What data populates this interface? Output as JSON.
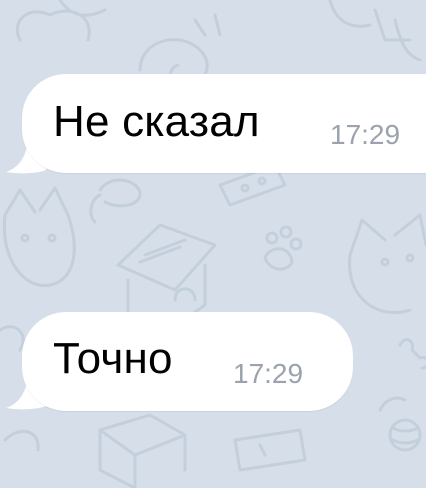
{
  "chat": {
    "background_color": "#d6dfe9",
    "pattern_color": "#c6d2de",
    "bubble_color": "#ffffff",
    "messages": [
      {
        "text": "Не сказал",
        "time": "17:29"
      },
      {
        "text": "Точно",
        "time": "17:29"
      }
    ]
  }
}
